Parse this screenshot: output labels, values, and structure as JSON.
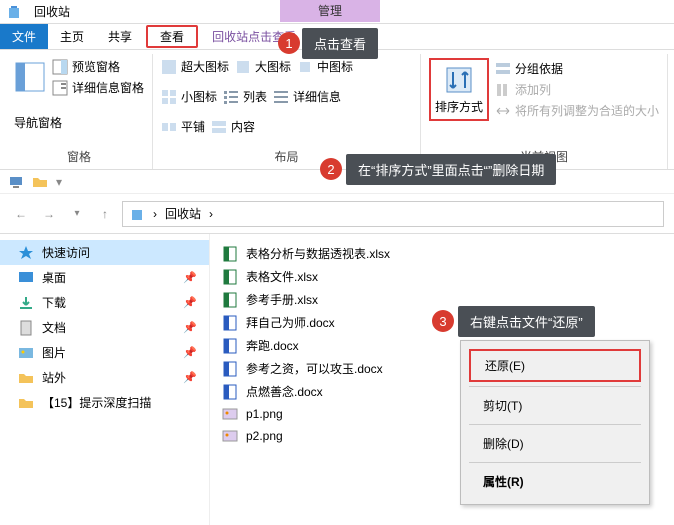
{
  "window": {
    "title": "回收站",
    "manage_tab": "管理"
  },
  "menubar": {
    "file": "文件",
    "home": "主页",
    "share": "共享",
    "view": "查看",
    "recycle_tools": "回收站点击查看"
  },
  "ribbon": {
    "nav_pane": "导航窗格",
    "preview_pane": "预览窗格",
    "details_pane": "详细信息窗格",
    "panes_label": "窗格",
    "xl_icons": "超大图标",
    "lg_icons": "大图标",
    "md_icons": "中图标",
    "sm_icons": "小图标",
    "list_view": "列表",
    "details_view": "详细信息",
    "tiles_view": "平铺",
    "content_view": "内容",
    "sort_by": "排序方式",
    "group_by": "分组依据",
    "add_columns": "添加列",
    "size_all": "将所有列调整为合适的大小",
    "layout_label": "布局",
    "currentview_label": "当前视图"
  },
  "callouts": {
    "c1": "点击查看",
    "c2": "在“排序方式”里面点击“”删除日期",
    "c3": "右键点击文件“还原”"
  },
  "badges": {
    "b1": "1",
    "b2": "2",
    "b3": "3"
  },
  "address": {
    "location": "回收站",
    "sep": "›"
  },
  "sidebar": {
    "quick": "快速访问",
    "desktop": "桌面",
    "downloads": "下载",
    "documents": "文档",
    "pictures": "图片",
    "ext": "站外",
    "item15": "【15】提示深度扫描"
  },
  "files": [
    "表格分析与数据透视表.xlsx",
    "表格文件.xlsx",
    "参考手册.xlsx",
    "拜自己为师.docx",
    "奔跑.docx",
    "参考之资，可以攻玉.docx",
    "点燃善念.docx",
    "p1.png",
    "p2.png"
  ],
  "filetypes": [
    "xlsx",
    "xlsx",
    "xlsx",
    "docx",
    "docx",
    "docx",
    "docx",
    "png",
    "png"
  ],
  "context": {
    "restore": "还原(E)",
    "cut": "剪切(T)",
    "delete": "删除(D)",
    "props": "属性(R)"
  }
}
